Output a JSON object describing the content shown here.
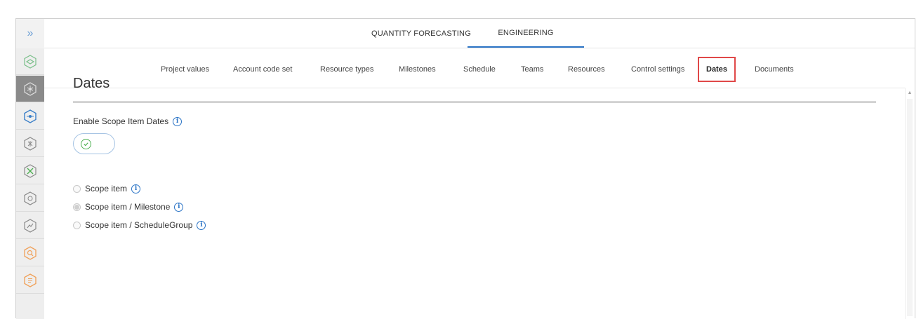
{
  "sidebar": {
    "expand_glyph": "»",
    "items": [
      {
        "icon": "layers-icon",
        "color": "#7bbf8a"
      },
      {
        "icon": "network-icon",
        "color": "#6b6b6b",
        "active": true
      },
      {
        "icon": "target-icon",
        "color": "#3a7fc8"
      },
      {
        "icon": "grid-icon",
        "color": "#8a8a8a"
      },
      {
        "icon": "tools-icon",
        "color": "#8a8a8a"
      },
      {
        "icon": "badge-icon",
        "color": "#8a8a8a"
      },
      {
        "icon": "chart-icon",
        "color": "#8a8a8a"
      },
      {
        "icon": "search-icon",
        "color": "#f0a058"
      },
      {
        "icon": "list-icon",
        "color": "#f0a058"
      }
    ]
  },
  "top_tabs": [
    {
      "label": "QUANTITY FORECASTING",
      "active": false
    },
    {
      "label": "ENGINEERING",
      "active": true
    }
  ],
  "sub_tabs": [
    {
      "label": "Project values"
    },
    {
      "label": "Account code set"
    },
    {
      "label": "Resource types"
    },
    {
      "label": "Milestones"
    },
    {
      "label": "Schedule"
    },
    {
      "label": "Teams"
    },
    {
      "label": "Resources"
    },
    {
      "label": "Control settings"
    },
    {
      "label": "Dates",
      "active": true
    },
    {
      "label": "Documents"
    }
  ],
  "page": {
    "title": "Dates",
    "enable_label": "Enable Scope Item Dates",
    "info_glyph": "i",
    "toggle_on": true,
    "options": [
      {
        "label": "Scope item",
        "checked": false
      },
      {
        "label": "Scope item / Milestone",
        "checked": true
      },
      {
        "label": "Scope item / ScheduleGroup",
        "checked": false
      }
    ]
  },
  "colors": {
    "accent": "#2b74c6",
    "highlight_box": "#e04848",
    "toggle_check": "#4caf50"
  }
}
